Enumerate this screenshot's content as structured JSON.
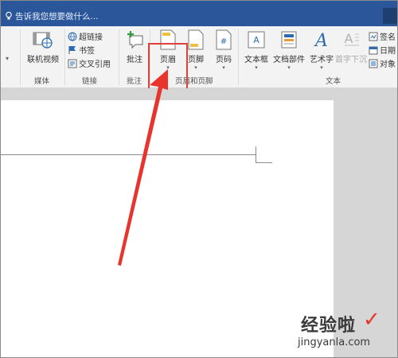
{
  "tellbar": {
    "text": "告诉我您想要做什么..."
  },
  "ribbon": {
    "partial_left_caret": "▾",
    "media": {
      "online_video": "联机视频",
      "group": "媒体"
    },
    "links": {
      "hyperlink": "超链接",
      "bookmark": "书签",
      "cross_reference": "交叉引用",
      "group": "链接"
    },
    "comments": {
      "comment": "批注",
      "group": "批注"
    },
    "header_footer": {
      "header": "页眉",
      "footer": "页脚",
      "page_number": "页码",
      "group": "页眉和页脚"
    },
    "text": {
      "textbox": "文本框",
      "quick_parts": "文档部件",
      "wordart": "艺术字",
      "drop_cap": "首字下沉",
      "signature": "签名",
      "datetime": "日期",
      "object": "对象",
      "group": "文本"
    }
  },
  "watermark": {
    "brand": "经验啦",
    "url": "jingyanla.com",
    "check": "✓"
  },
  "colors": {
    "title_blue": "#2b579a",
    "highlight_red": "#e0403a",
    "arrow_red": "#e8342c"
  }
}
